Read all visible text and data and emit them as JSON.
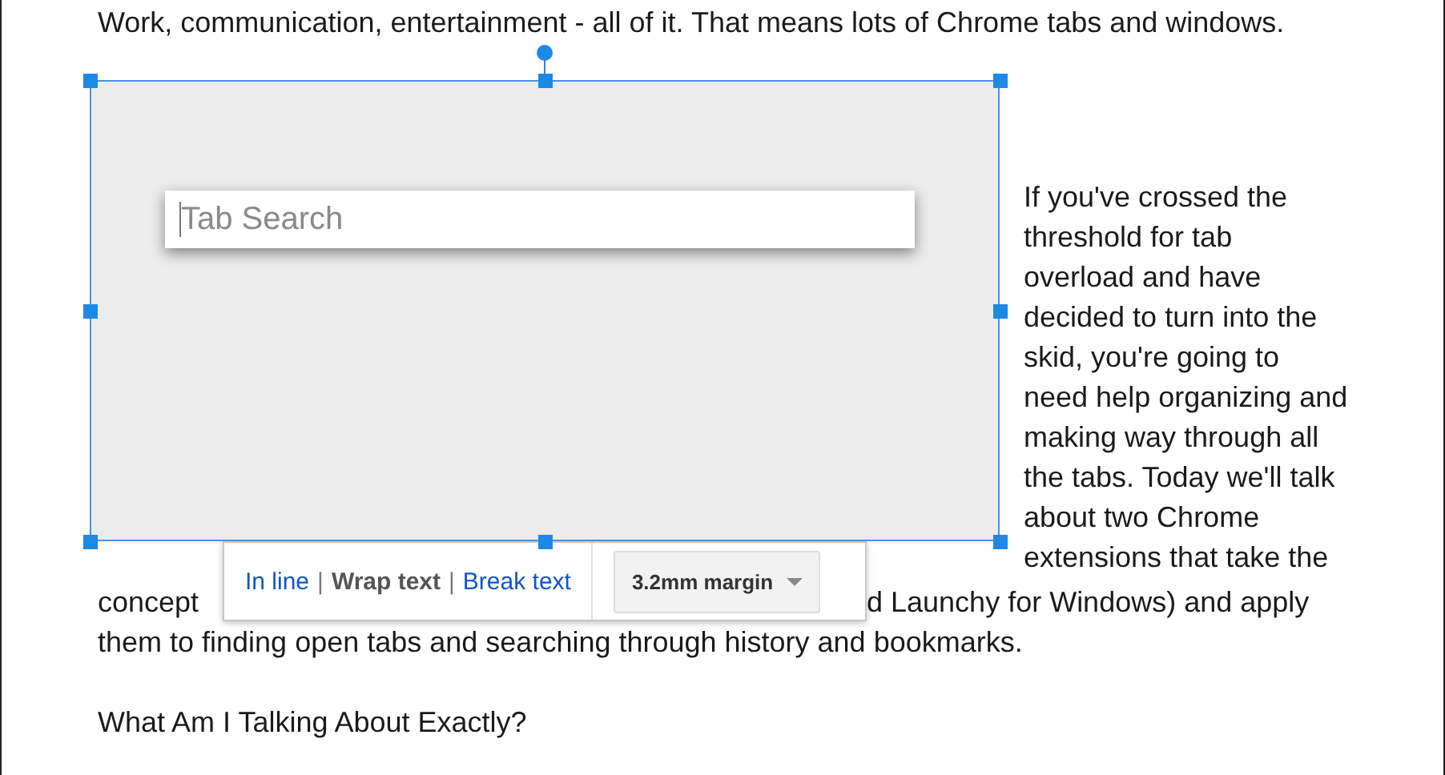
{
  "intro_line": "Work, communication, entertainment - all of it. That means lots of Chrome tabs and windows.",
  "image": {
    "search": {
      "placeholder": "Tab Search"
    }
  },
  "side_lines": [
    "If you've crossed the",
    "threshold for tab",
    "overload and have",
    "decided to turn into the",
    "skid, you're going to",
    "need help organizing and",
    "making way through all",
    "the tabs. Today we'll talk",
    "about two Chrome",
    "extensions that take the"
  ],
  "covered_line": {
    "start": "concept",
    "end": "d Launchy for Windows) and apply"
  },
  "after_lines": [
    "them to finding open tabs and searching through history and bookmarks."
  ],
  "heading": "What Am I Talking About Exactly?",
  "wrap_toolbar": {
    "items": [
      {
        "kind": "option",
        "label": "In line",
        "selected": false
      },
      {
        "kind": "separator",
        "label": "|"
      },
      {
        "kind": "option",
        "label": "Wrap text",
        "selected": true
      },
      {
        "kind": "separator",
        "label": "|"
      },
      {
        "kind": "option",
        "label": "Break text",
        "selected": false
      }
    ],
    "margin_dropdown": {
      "label": "3.2mm margin"
    }
  }
}
